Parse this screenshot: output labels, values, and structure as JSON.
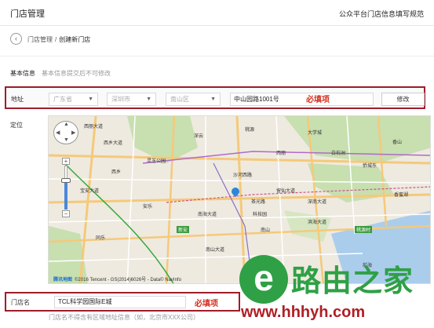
{
  "header": {
    "title": "门店管理",
    "guide_link": "公众平台门店信息填写规范"
  },
  "breadcrumb": {
    "back_icon": "chevron-left-icon",
    "parent": "门店管理",
    "separator": "/",
    "current": "创建新门店"
  },
  "basic_info": {
    "title": "基本信息",
    "note": "基本信息提交后不可修改"
  },
  "address": {
    "label": "地址",
    "province": "广东省",
    "city": "深圳市",
    "district": "南山区",
    "street": "中山园路1001号",
    "required_tag": "必填项",
    "edit_button": "修改"
  },
  "location": {
    "label": "定位"
  },
  "map": {
    "zoom_level_fraction": 0.66,
    "zoom_plus": "+",
    "zoom_minus": "−",
    "pan_up": "▲",
    "pan_down": "▼",
    "pan_left": "◀",
    "pan_right": "▶",
    "provider_logo": "腾讯地图",
    "copyright": "©2016 Tencent - GS(2014)6026号 - Data© NavInfo",
    "labels": [
      {
        "id": "xili-dadao",
        "text": "西丽大道"
      },
      {
        "id": "xiuxin-lu",
        "text": "西乡大道"
      },
      {
        "id": "xixiang",
        "text": "西乡"
      },
      {
        "id": "lingzhi-park",
        "text": "灵芝公园"
      },
      {
        "id": "anle",
        "text": "安乐"
      },
      {
        "id": "shenyun",
        "text": "深云"
      },
      {
        "id": "baishizhou",
        "text": "白石洲"
      },
      {
        "id": "shahe-xi",
        "text": "沙河西路"
      },
      {
        "id": "qiaocheng",
        "text": "侨城东"
      },
      {
        "id": "xinan",
        "text": "新安"
      },
      {
        "id": "nanshan",
        "text": "南山"
      },
      {
        "id": "guanlan",
        "text": "留仙大道"
      },
      {
        "id": "taoyuan",
        "text": "桃源"
      },
      {
        "id": "daxuecheng",
        "text": "大学城"
      },
      {
        "id": "nanhai",
        "text": "南海大道"
      },
      {
        "id": "qianhai",
        "text": "前海"
      },
      {
        "id": "baoan",
        "text": "宝安大道"
      },
      {
        "id": "xili",
        "text": "西丽"
      },
      {
        "id": "chaguang",
        "text": "茶光路"
      },
      {
        "id": "tongyu",
        "text": "同乐"
      },
      {
        "id": "kejiyuan",
        "text": "科技园"
      },
      {
        "id": "xiangmi",
        "text": "香蜜湖"
      },
      {
        "id": "binhai",
        "text": "滨海大道"
      },
      {
        "id": "nanshan-dadao",
        "text": "南山大道"
      },
      {
        "id": "taoyuancun",
        "text": "桃源村"
      },
      {
        "id": "xiangshan",
        "text": "香山"
      },
      {
        "id": "xiaomeisha",
        "text": "深南大道"
      }
    ]
  },
  "store_name": {
    "label": "门店名",
    "value": "TCL科学园国际E城",
    "required_tag": "必填项",
    "hint": "门店名不得含有区域地址信息（如，北京市XXX公司）"
  },
  "watermark": {
    "icon_glyph": "e",
    "text": "路由之家",
    "url": "www.hhhyh.com"
  },
  "colors": {
    "required_red": "#d42f1f",
    "highlight_border": "#a01c2a",
    "watermark_green": "#2fa045",
    "map_pin": "#2f86d6"
  }
}
